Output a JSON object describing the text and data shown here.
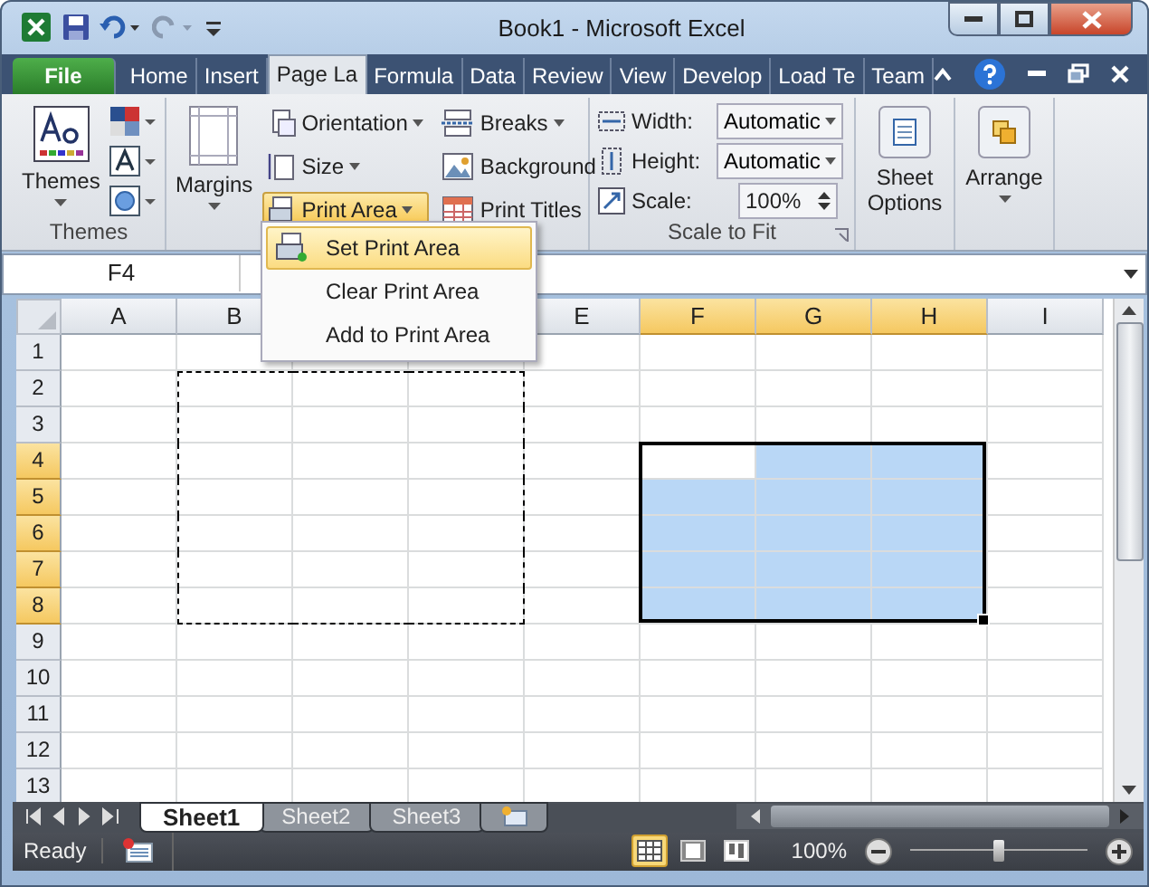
{
  "window": {
    "title": "Book1  -  Microsoft Excel"
  },
  "tabs": [
    {
      "label": "File",
      "kind": "file",
      "selected": false
    },
    {
      "label": "Home",
      "selected": false
    },
    {
      "label": "Insert",
      "selected": false
    },
    {
      "label": "Page La",
      "selected": true
    },
    {
      "label": "Formula",
      "selected": false
    },
    {
      "label": "Data",
      "selected": false
    },
    {
      "label": "Review",
      "selected": false
    },
    {
      "label": "View",
      "selected": false
    },
    {
      "label": "Develop",
      "selected": false
    },
    {
      "label": "Load Te",
      "selected": false
    },
    {
      "label": "Team",
      "selected": false
    }
  ],
  "ribbon": {
    "themes": {
      "button": "Themes",
      "group": "Themes"
    },
    "page_setup": {
      "margins": "Margins",
      "orientation": "Orientation",
      "size": "Size",
      "print_area": "Print Area",
      "breaks": "Breaks",
      "background": "Background",
      "print_titles": "Print Titles"
    },
    "scale_to_fit": {
      "group": "Scale to Fit",
      "width_label": "Width:",
      "width_value": "Automatic",
      "height_label": "Height:",
      "height_value": "Automatic",
      "scale_label": "Scale:",
      "scale_value": "100%"
    },
    "sheet_options": "Sheet Options",
    "arrange": "Arrange"
  },
  "print_area_menu": [
    {
      "label": "Set Print Area",
      "selected": true
    },
    {
      "label": "Clear Print Area",
      "selected": false
    },
    {
      "label": "Add to Print Area",
      "selected": false
    }
  ],
  "name_box": "F4",
  "columns": [
    {
      "label": "A",
      "selected": false,
      "print_area": false
    },
    {
      "label": "B",
      "selected": false,
      "print_area": true
    },
    {
      "print_area": true
    },
    {
      "print_area": true
    },
    {
      "label": "E",
      "selected": false,
      "print_area": false
    },
    {
      "label": "F",
      "selected": true,
      "print_area": false
    },
    {
      "label": "G",
      "selected": true,
      "print_area": false
    },
    {
      "label": "H",
      "selected": true,
      "print_area": false
    },
    {
      "label": "I",
      "selected": false,
      "print_area": false
    }
  ],
  "rows": [
    {
      "label": "1",
      "selected": false,
      "print_area": false
    },
    {
      "label": "2",
      "selected": false,
      "print_area": true
    },
    {
      "label": "3",
      "selected": false,
      "print_area": true
    },
    {
      "label": "4",
      "selected": true,
      "print_area": true
    },
    {
      "label": "5",
      "selected": true,
      "print_area": true
    },
    {
      "label": "6",
      "selected": true,
      "print_area": true
    },
    {
      "label": "7",
      "selected": true,
      "print_area": true
    },
    {
      "label": "8",
      "selected": true,
      "print_area": true
    },
    {
      "label": "9",
      "selected": false,
      "print_area": false
    },
    {
      "label": "10",
      "selected": false,
      "print_area": false
    },
    {
      "label": "11",
      "selected": false,
      "print_area": false
    },
    {
      "label": "12",
      "selected": false,
      "print_area": false
    },
    {
      "label": "13",
      "selected": false,
      "print_area": false
    }
  ],
  "sheets": [
    {
      "label": "Sheet1",
      "selected": true
    },
    {
      "label": "Sheet2",
      "selected": false
    },
    {
      "label": "Sheet3",
      "selected": false
    }
  ],
  "status_bar": {
    "text": "Ready",
    "zoom": "100%",
    "zoom_slider": {
      "level": 0.5
    },
    "views": [
      {
        "kind": "normal",
        "selected": true
      },
      {
        "kind": "layout",
        "selected": false
      },
      {
        "kind": "break",
        "selected": false
      }
    ]
  }
}
